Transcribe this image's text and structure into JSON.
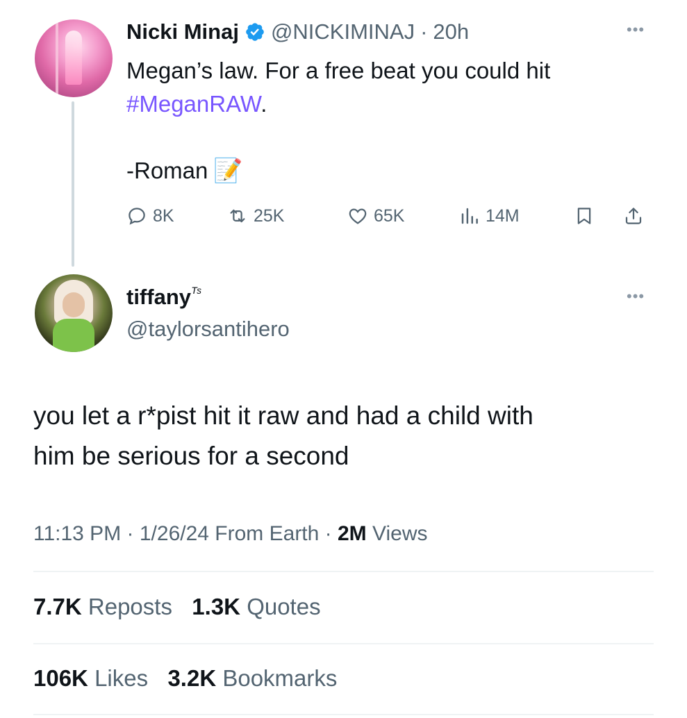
{
  "parent_tweet": {
    "name": "Nicki Minaj",
    "handle": "@NICKIMINAJ",
    "separator": "·",
    "time": "20h",
    "text_line1": "Megan’s law. For a free beat you could hit",
    "hashtag": "#MeganRAW",
    "hashtag_suffix": ".",
    "signature": "-Roman",
    "signature_emoji": "📝",
    "actions": {
      "replies": "8K",
      "reposts": "25K",
      "likes": "65K",
      "views": "14M"
    }
  },
  "reply_tweet": {
    "name": "tiffany",
    "name_suffix": "ᵀˢ",
    "handle": "@taylorsantihero",
    "text_line1": "you let a r*pist hit it raw and had a child with",
    "text_line2": "him be serious for a second",
    "time": "11:13 PM",
    "date": "1/26/24",
    "source": "From Earth",
    "views_count": "2M",
    "views_label": "Views",
    "stats": {
      "reposts_count": "7.7K",
      "reposts_label": "Reposts",
      "quotes_count": "1.3K",
      "quotes_label": "Quotes",
      "likes_count": "106K",
      "likes_label": "Likes",
      "bookmarks_count": "3.2K",
      "bookmarks_label": "Bookmarks"
    }
  },
  "icons": {
    "more": "more-horizontal-icon",
    "verified": "verified-badge-icon",
    "reply": "reply-icon",
    "repost": "repost-icon",
    "like": "heart-icon",
    "views": "views-icon",
    "bookmark": "bookmark-icon",
    "share": "share-icon"
  },
  "colors": {
    "accent": "#7856ff",
    "verified": "#1d9bf0",
    "secondary_text": "#536471"
  }
}
